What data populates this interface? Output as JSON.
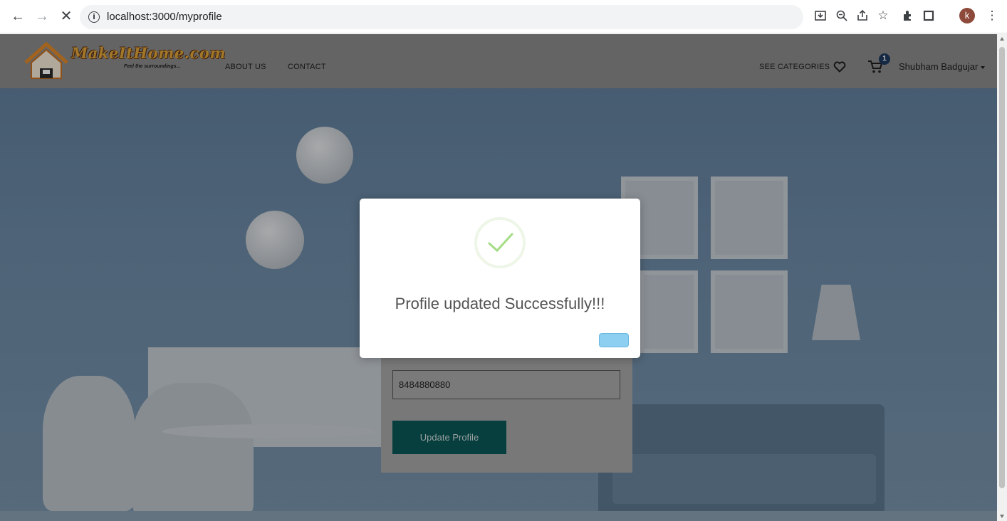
{
  "browser": {
    "url": "localhost:3000/myprofile",
    "profile_initial": "k",
    "back_icon": "arrow-left-icon",
    "forward_icon": "arrow-right-icon",
    "stop_icon": "close-icon"
  },
  "navbar": {
    "brand": "MakeItHome.com",
    "tagline": "Feel the surroundings...",
    "links": [
      "ABOUT US",
      "CONTACT"
    ],
    "categories": "SEE CATEGORIES",
    "cart_count": "1",
    "user_name": "Shubham Badgujar"
  },
  "form": {
    "phone_value": "8484880880",
    "update_button": "Update Profile"
  },
  "modal": {
    "title": "Profile updated Successfully!!!",
    "confirm_button": ""
  },
  "colors": {
    "update_button": "#0a5656",
    "success_check": "#a5dc86",
    "confirm_button": "#8ccff0"
  }
}
